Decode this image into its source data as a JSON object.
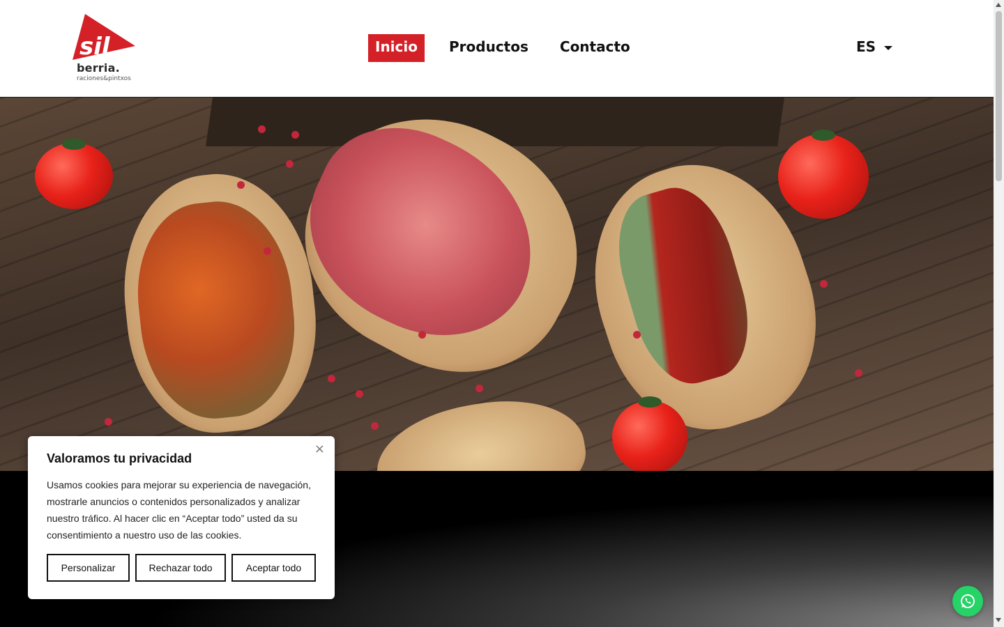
{
  "header": {
    "logo": {
      "word": "berria.",
      "tagline": "raciones&pintxos"
    },
    "nav": [
      {
        "label": "Inicio",
        "active": true
      },
      {
        "label": "Productos",
        "active": false
      },
      {
        "label": "Contacto",
        "active": false
      }
    ],
    "language": "ES"
  },
  "colors": {
    "brand_red": "#d42027",
    "whatsapp_green": "#25d366"
  },
  "cookie_banner": {
    "title": "Valoramos tu privacidad",
    "text": "Usamos cookies para mejorar su experiencia de navegación, mostrarle anuncios o contenidos personalizados y analizar nuestro tráfico. Al hacer clic en “Aceptar todo” usted da su consentimiento a nuestro uso de las cookies.",
    "close_icon": "close-icon",
    "buttons": {
      "customize": "Personalizar",
      "reject": "Rechazar todo",
      "accept": "Aceptar todo"
    }
  },
  "whatsapp_icon": "whatsapp-icon"
}
